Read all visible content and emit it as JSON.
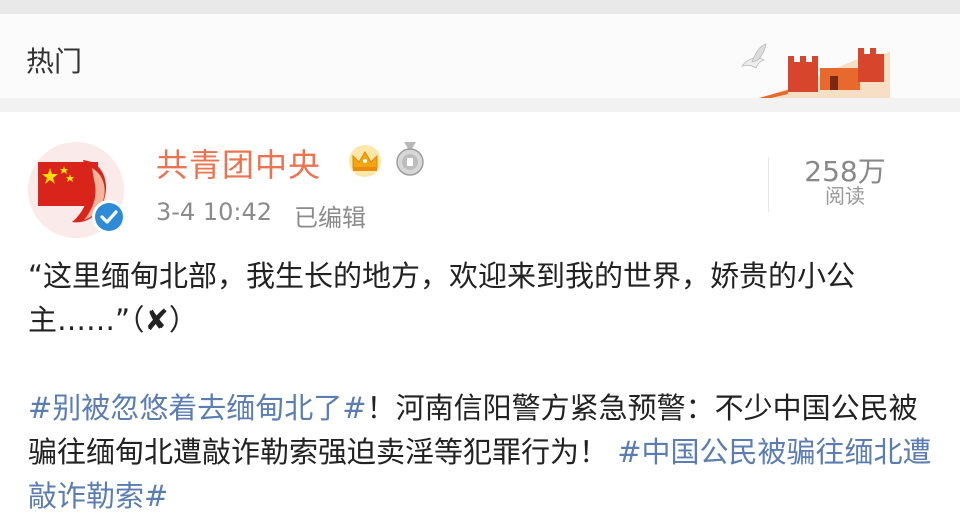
{
  "header": {
    "title": "热门"
  },
  "post": {
    "user_name": "共青团中央",
    "time": "3-4 10:42",
    "edited": "已编辑",
    "read_count": "258万",
    "read_label": "阅读",
    "quote_text": "“这里缅甸北部，我生长的地方，欢迎来到我的世界，娇贵的小公主……”（",
    "quote_mark": "✘",
    "quote_close": "）",
    "hashtag_1": "#别被忽悠着去缅甸北了#",
    "body_text": "！河南信阳警方紧急预警：不少中国公民被骗往缅甸北遭敲诈勒索强迫卖淫等犯罪行为！ ",
    "hashtag_2": "#中国公民被骗往缅北遭敲诈勒索#"
  },
  "icons": {
    "crown": "crown-icon",
    "medal": "medal-icon",
    "verified": "verified-check-icon",
    "wall": "great-wall-icon",
    "dove": "dove-icon"
  },
  "colors": {
    "user_name": "#eb7350",
    "hashtag": "#5b7db1",
    "text": "#222222",
    "meta": "#8b8b8b",
    "verified": "#2e8bd8"
  }
}
